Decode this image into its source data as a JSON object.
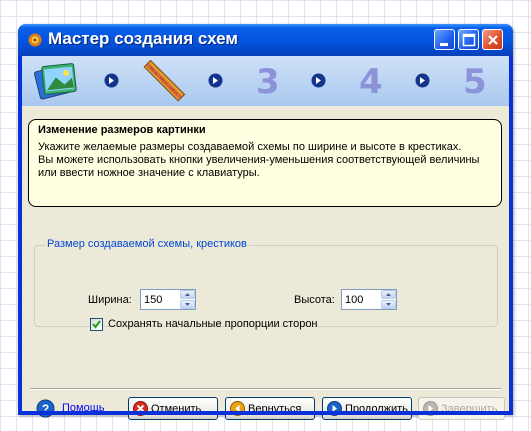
{
  "window": {
    "title": "Мастер создания схем"
  },
  "steps": {
    "items": [
      "3",
      "4",
      "5"
    ]
  },
  "info": {
    "title": "Изменение размеров картинки",
    "line1": "Укажите желаемые размеры создаваемой схемы по ширине и высоте в крестиках.",
    "line2": "Вы можете использовать кнопки увеличения-уменьшения соответствующей величины",
    "line3": "или ввести ножное значение с клавиатуры."
  },
  "size_group": {
    "label": "Размер создаваемой схемы, крестиков",
    "width_label": "Ширина:",
    "width_value": "150",
    "height_label": "Высота:",
    "height_value": "100",
    "keep_proportions_label": "Сохранять начальные пропорции сторон",
    "keep_proportions_checked": true
  },
  "footer": {
    "help_label": "Помощь",
    "cancel_label": "Отменить",
    "back_label": "Вернуться",
    "next_label": "Продолжить",
    "finish_label": "Завершить"
  },
  "colors": {
    "titlebar": "#0555e3",
    "step_number": "#8c93d8",
    "info_bg": "#ffffe1",
    "group_label": "#0046d5",
    "link": "#0000ff"
  }
}
